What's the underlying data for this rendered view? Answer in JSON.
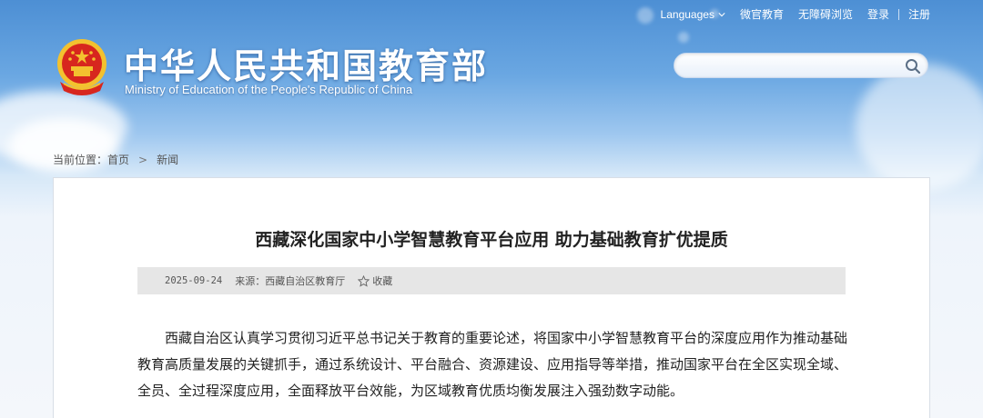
{
  "topbar": {
    "languages": "Languages",
    "weibo": "微官教育",
    "accessibility": "无障碍浏览",
    "login": "登录",
    "register": "注册"
  },
  "header": {
    "title": "中华人民共和国教育部",
    "subtitle": "Ministry of Education of the People's Republic of China"
  },
  "search": {
    "value": "",
    "placeholder": ""
  },
  "breadcrumb": {
    "label": "当前位置：",
    "home": "首页",
    "separator": ">",
    "current": "新闻"
  },
  "article": {
    "title": "西藏深化国家中小学智慧教育平台应用 助力基础教育扩优提质",
    "date": "2025-09-24",
    "source": "来源：西藏自治区教育厅",
    "favorite": "收藏",
    "body": "西藏自治区认真学习贯彻习近平总书记关于教育的重要论述，将国家中小学智慧教育平台的深度应用作为推动基础教育高质量发展的关键抓手，通过系统设计、平台融合、资源建设、应用指导等举措，推动国家平台在全区实现全域、全员、全过程深度应用，全面释放平台效能，为区域教育优质均衡发展注入强劲数字动能。"
  },
  "colors": {
    "sky_top": "#4d8fd4",
    "sky_bottom": "#eef4fb",
    "emblem_red": "#d7261e",
    "emblem_gold": "#f3c12f",
    "meta_bar": "#e6e6e6"
  },
  "icons": {
    "emblem": "national-emblem",
    "search": "magnifier",
    "favorite": "star",
    "languages": "chevron-down"
  }
}
